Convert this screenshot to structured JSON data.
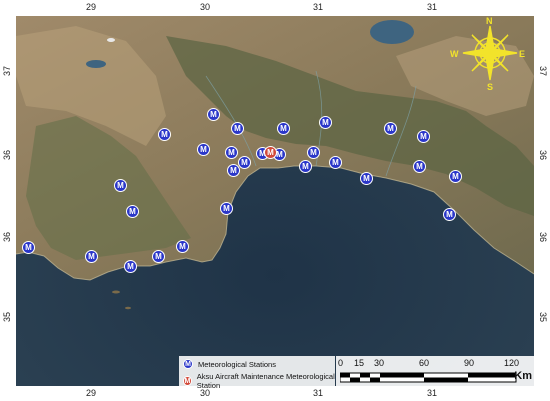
{
  "ticks": {
    "top": [
      "29",
      "30",
      "31",
      "31"
    ],
    "bottom": [
      "29",
      "30",
      "31",
      "31"
    ],
    "left": [
      "37",
      "36",
      "36",
      "35"
    ],
    "right": [
      "37",
      "36",
      "36",
      "35"
    ]
  },
  "compass": {
    "n": "N",
    "s": "S",
    "e": "E",
    "w": "W",
    "color": "#f2e32b"
  },
  "legend": {
    "items": [
      {
        "label": "Meteorological Stations",
        "symbol": "M",
        "color": "#2a36c9"
      },
      {
        "label": "Aksu Aircraft Maintenance Meteorological Station",
        "symbol": "M",
        "color": "#d24a3a"
      }
    ]
  },
  "scale": {
    "labels": [
      "0",
      "15",
      "30",
      "60",
      "90",
      "120"
    ],
    "unit": "Km"
  },
  "stations": [
    {
      "symbol": "M",
      "type": "met"
    },
    {
      "symbol": "M",
      "type": "met"
    },
    {
      "symbol": "M",
      "type": "met"
    },
    {
      "symbol": "M",
      "type": "met"
    },
    {
      "symbol": "M",
      "type": "met"
    },
    {
      "symbol": "M",
      "type": "met"
    },
    {
      "symbol": "M",
      "type": "met"
    },
    {
      "symbol": "M",
      "type": "met"
    },
    {
      "symbol": "M",
      "type": "met"
    },
    {
      "symbol": "M",
      "type": "met"
    },
    {
      "symbol": "M",
      "type": "met"
    },
    {
      "symbol": "M",
      "type": "met"
    },
    {
      "symbol": "M",
      "type": "met"
    },
    {
      "symbol": "M",
      "type": "met"
    },
    {
      "symbol": "M",
      "type": "met"
    },
    {
      "symbol": "M",
      "type": "met"
    },
    {
      "symbol": "M",
      "type": "met"
    },
    {
      "symbol": "M",
      "type": "met"
    },
    {
      "symbol": "M",
      "type": "met"
    },
    {
      "symbol": "M",
      "type": "met"
    },
    {
      "symbol": "M",
      "type": "met"
    },
    {
      "symbol": "M",
      "type": "met"
    },
    {
      "symbol": "M",
      "type": "met"
    },
    {
      "symbol": "M",
      "type": "met"
    },
    {
      "symbol": "M",
      "type": "met"
    },
    {
      "symbol": "M",
      "type": "met"
    },
    {
      "symbol": "M",
      "type": "met"
    },
    {
      "symbol": "M",
      "type": "met"
    },
    {
      "symbol": "M",
      "type": "aksu"
    }
  ]
}
